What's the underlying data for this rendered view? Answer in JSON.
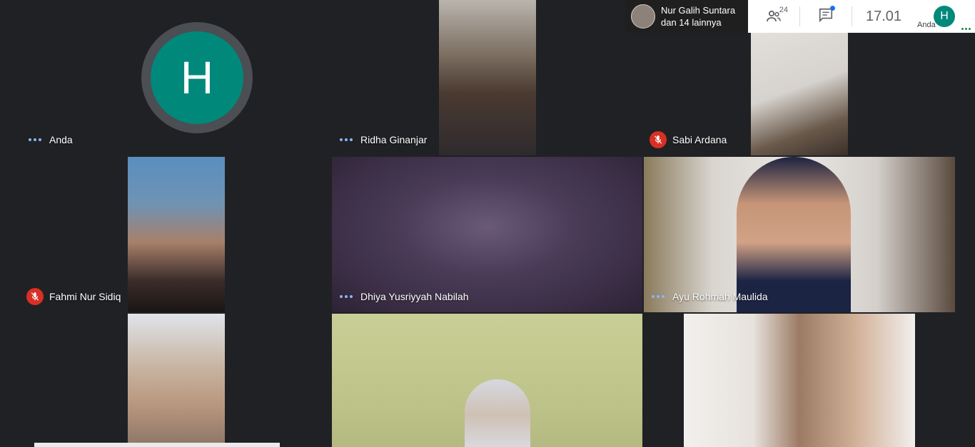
{
  "presenter": {
    "name": "Nur Galih Suntara",
    "others": "dan 14 lainnya"
  },
  "topbar": {
    "participants_count": "24",
    "clock": "17.01",
    "self_initial": "H",
    "self_label": "Anda"
  },
  "tiles": [
    {
      "name": "Anda",
      "status": "speaking-dots",
      "initial": "H"
    },
    {
      "name": "Ridha Ginanjar",
      "status": "speaking-dots"
    },
    {
      "name": "Sabi Ardana",
      "status": "muted"
    },
    {
      "name": "Fahmi Nur Sidiq",
      "status": "muted"
    },
    {
      "name": "Dhiya Yusriyyah Nabilah",
      "status": "speaking-dots"
    },
    {
      "name": "Ayu Rohmah Maulida",
      "status": "speaking-dots"
    }
  ],
  "colors": {
    "background": "#202124",
    "tile": "#3c4043",
    "avatar": "#00897b",
    "muted": "#d93025",
    "dots": "#8ab4f8"
  }
}
